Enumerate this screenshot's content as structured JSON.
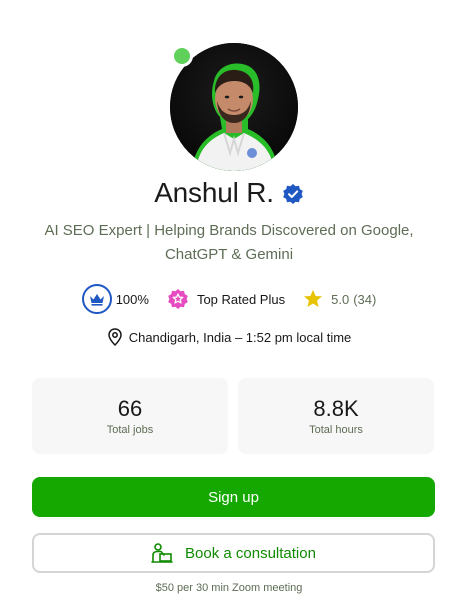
{
  "profile": {
    "name": "Anshul R.",
    "title": "AI SEO Expert | Helping Brands Discovered on Google, ChatGPT & Gemini",
    "online": true,
    "verified": true
  },
  "stats": {
    "job_success": "100%",
    "badge": "Top Rated Plus",
    "rating": "5.0",
    "rating_count": "(34)"
  },
  "location": {
    "text": "Chandigarh, India – 1:52 pm local time"
  },
  "cards": [
    {
      "value": "66",
      "label": "Total jobs"
    },
    {
      "value": "8.8K",
      "label": "Total hours"
    }
  ],
  "actions": {
    "signup_label": "Sign up",
    "consult_label": "Book a consultation",
    "consult_note": "$50 per 30 min Zoom meeting"
  },
  "icons": {
    "online": "online-status-dot",
    "verified": "verified-badge-icon",
    "jss": "crown-icon",
    "top_rated": "top-rated-plus-icon",
    "rating": "star-icon",
    "location": "location-pin-icon",
    "consult": "consultation-icon"
  },
  "colors": {
    "brand_green": "#14a800",
    "online_green": "#5fd05a",
    "verified_blue": "#1f57c3",
    "star_yellow": "#e8c300",
    "top_rated_pink": "#e74bc2"
  }
}
